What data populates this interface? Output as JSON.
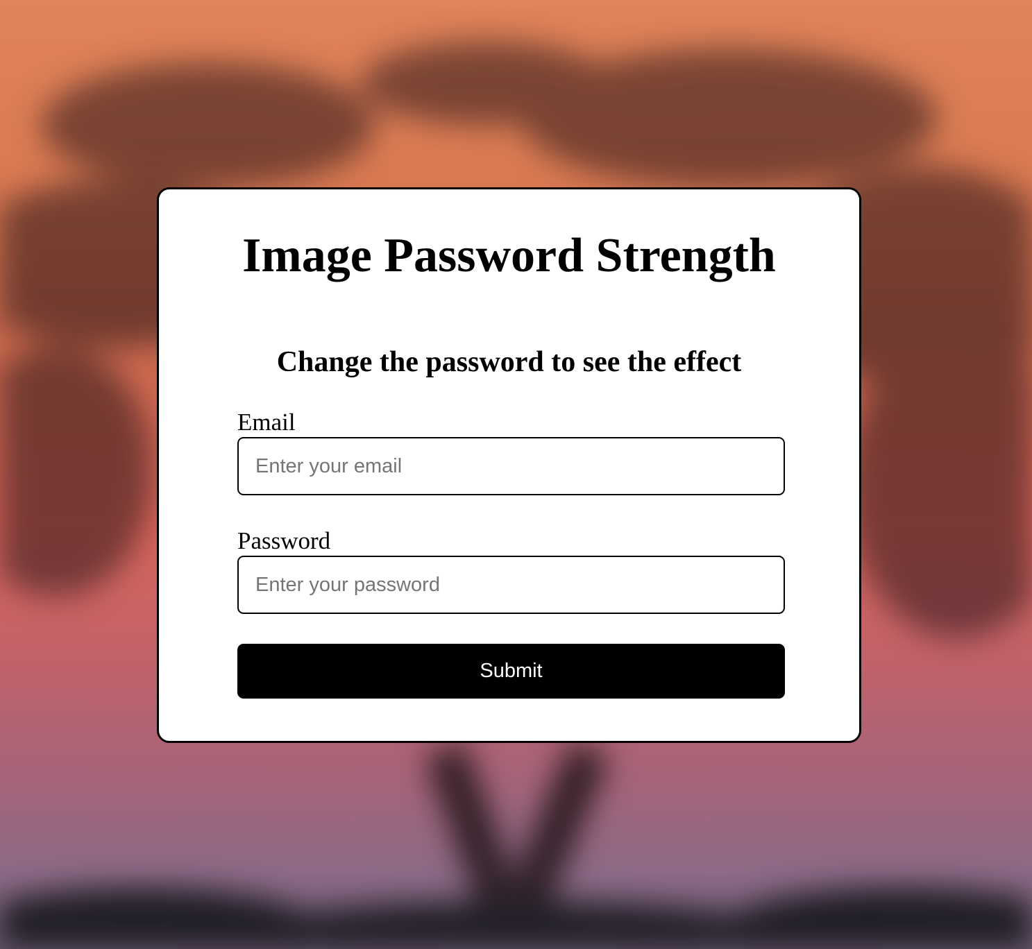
{
  "page": {
    "title": "Image Password Strength",
    "subtitle": "Change the password to see the effect"
  },
  "form": {
    "email": {
      "label": "Email",
      "value": "",
      "placeholder": "Enter your email"
    },
    "password": {
      "label": "Password",
      "value": "",
      "placeholder": "Enter your password"
    },
    "submit_label": "Submit"
  },
  "colors": {
    "card_background": "#ffffff",
    "border": "#000000",
    "button_background": "#000000",
    "button_text": "#ffffff",
    "placeholder": "#757575",
    "background_top": "#e0845a",
    "background_bottom": "#6f5e74"
  }
}
